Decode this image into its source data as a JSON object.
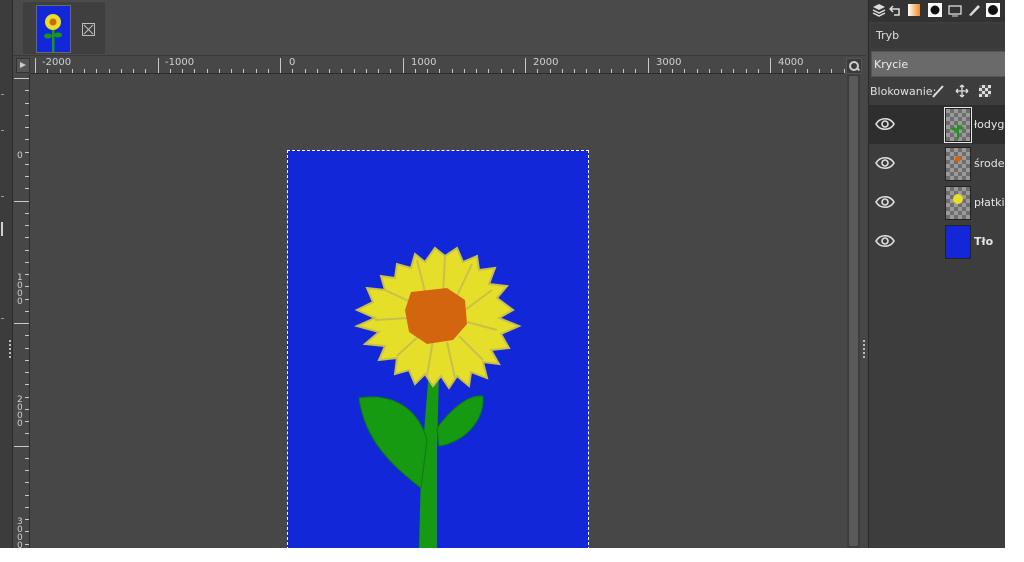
{
  "image_tab": {
    "thumbnail_icon": "sunflower-thumbnail",
    "close_icon": "close-icon"
  },
  "ruler": {
    "horizontal_labels": [
      "-2000",
      "-1000",
      "0",
      "1000",
      "2000",
      "3000",
      "4000"
    ],
    "vertical_labels": [
      "0",
      "1000",
      "2000",
      "3000"
    ]
  },
  "canvas": {
    "background_color": "#1228d8",
    "stem_color": "#159a12",
    "petal_color": "#e6df2a",
    "center_color": "#d4650f"
  },
  "layers_panel": {
    "dock_tab_icons": [
      "layers-icon",
      "undo-history-icon",
      "gradient-icon",
      "brush-icon",
      "device-icon",
      "pencil-icon",
      "pattern-icon"
    ],
    "mode_label": "Tryb",
    "opacity_label": "Krycie",
    "lock_label": "Blokowanie:",
    "lock_icons": [
      "lock-pixels-icon",
      "lock-position-icon",
      "lock-alpha-icon"
    ],
    "layers": [
      {
        "name": "łodyga",
        "selected": true,
        "visible": true,
        "thumb": "stem"
      },
      {
        "name": "środek",
        "selected": false,
        "visible": true,
        "thumb": "center"
      },
      {
        "name": "płatki",
        "selected": false,
        "visible": true,
        "thumb": "petals"
      },
      {
        "name": "Tło",
        "selected": false,
        "visible": true,
        "thumb": "background"
      }
    ]
  }
}
